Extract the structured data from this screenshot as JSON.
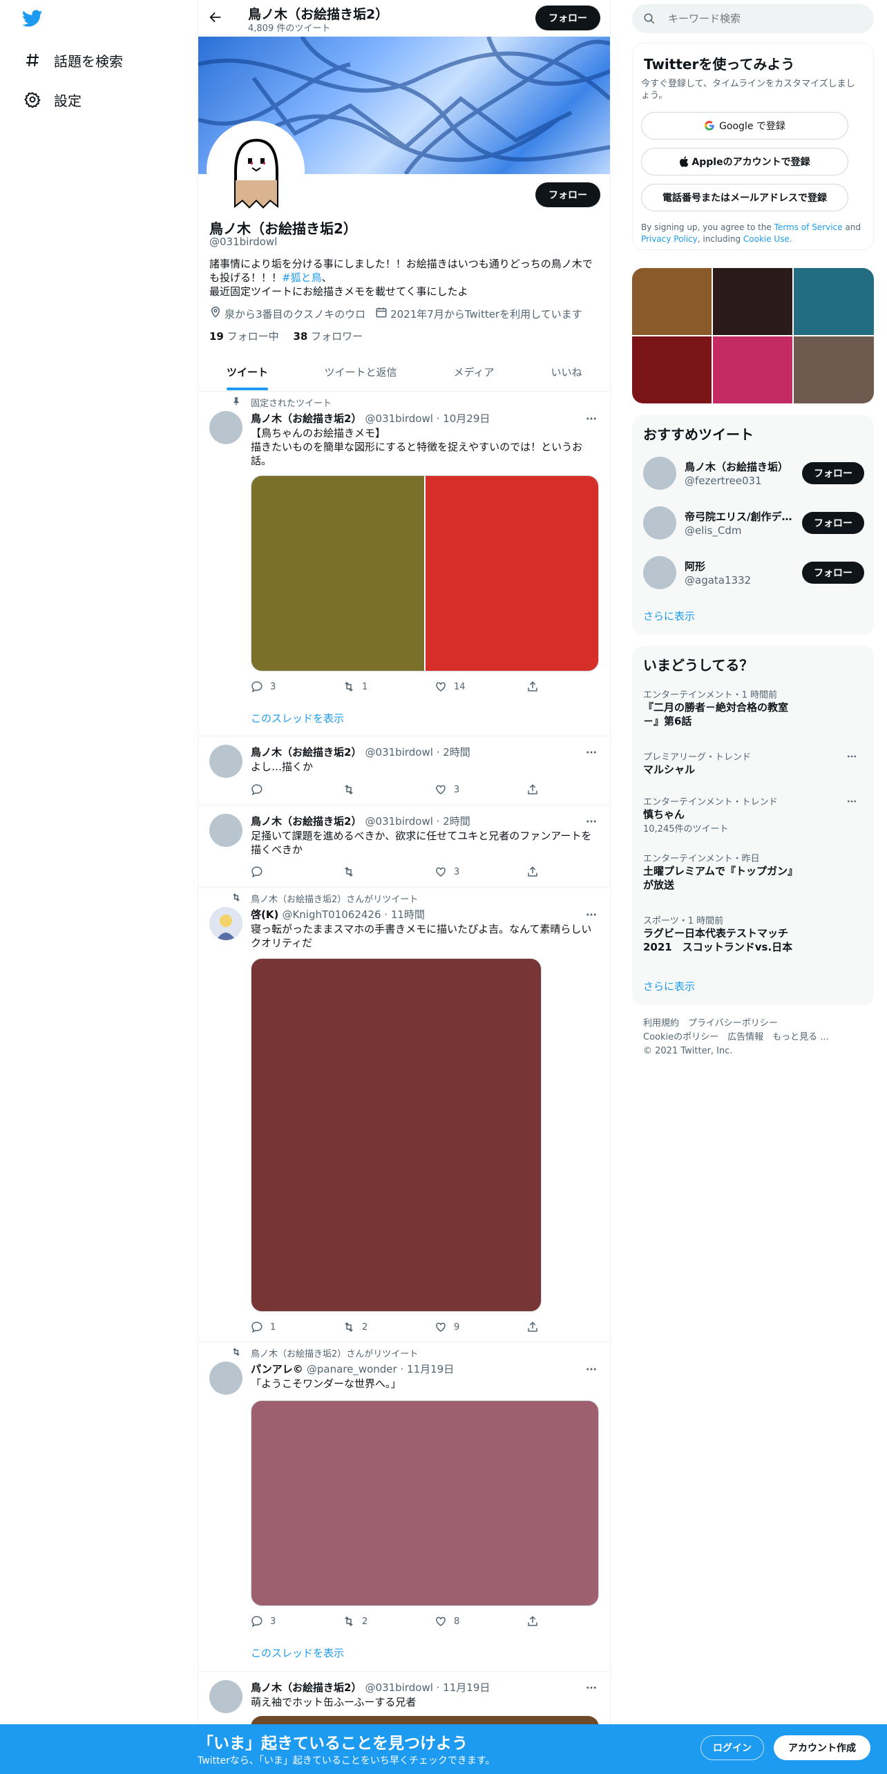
{
  "nav": {
    "explore_label": "話題を検索",
    "settings_label": "設定"
  },
  "header": {
    "title": "鳥ノ木（お絵描き垢2）",
    "tweet_count": "4,809 件のツイート",
    "follow_label": "フォロー"
  },
  "profile": {
    "follow_label": "フォロー",
    "name": "鳥ノ木（お絵描き垢2）",
    "handle": "@031birdowl",
    "bio_line1": "諸事情により垢を分ける事にしました！！お絵描きはいつも通りどっちの鳥ノ木でも投げる！！！",
    "bio_hashtag": "#狐と鳥",
    "bio_comma": "、",
    "bio_line2": "最近固定ツイートにお絵描きメモを載せてく事にしたよ",
    "location": "泉から3番目のクスノキのウロ",
    "joined": "2021年7月からTwitterを利用しています",
    "following_count": "19",
    "following_label": "フォロー中",
    "followers_count": "38",
    "followers_label": "フォロワー"
  },
  "tabs": [
    "ツイート",
    "ツイートと返信",
    "メディア",
    "いいね"
  ],
  "tweets": [
    {
      "context": "固定されたツイート",
      "name": "鳥ノ木（お絵描き垢2）",
      "handle": "@031birdowl",
      "time": "10月29日",
      "text1": "【鳥ちゃんのお絵描きメモ】",
      "text2": "描きたいものを簡単な図形にすると特徴を捉えやすいのでは！というお話。",
      "replies": "3",
      "retweets": "1",
      "likes": "14",
      "thread": "このスレッドを表示",
      "media_colors": [
        "#7a702a",
        "#d62f2a"
      ]
    },
    {
      "name": "鳥ノ木（お絵描き垢2）",
      "handle": "@031birdowl",
      "time": "2時間",
      "text": "よし…描くか",
      "likes": "3"
    },
    {
      "name": "鳥ノ木（お絵描き垢2）",
      "handle": "@031birdowl",
      "time": "2時間",
      "text": "足掻いて課題を進めるべきか、欲求に任せてユキと兄者のファンアートを描くべきか",
      "likes": "3"
    },
    {
      "context": "鳥ノ木（お絵描き垢2）さんがリツイート",
      "name": "啓(K)",
      "handle": "@KnighT01062426",
      "time": "11時間",
      "text": "寝っ転がったままスマホの手書きメモに描いたぴよ吉。なんて素晴らしいクオリティだ",
      "replies": "1",
      "retweets": "2",
      "likes": "9",
      "media_color": "#773536"
    },
    {
      "context": "鳥ノ木（お絵描き垢2）さんがリツイート",
      "name": "パンアレ©",
      "handle": "@panare_wonder",
      "time": "11月19日",
      "text": "「ようこそワンダーな世界へ。」",
      "replies": "3",
      "retweets": "2",
      "likes": "8",
      "thread": "このスレッドを表示",
      "media_color": "#9e606e"
    },
    {
      "name": "鳥ノ木（お絵描き垢2）",
      "handle": "@031birdowl",
      "time": "11月19日",
      "text": "萌え袖でホット缶ふーふーする兄者",
      "media_color": "#6e4a2a"
    }
  ],
  "sidebar": {
    "search_placeholder": "キーワード検索",
    "signup": {
      "title": "Twitterを使ってみよう",
      "subtitle": "今すぐ登録して、タイムラインをカスタマイズしましょう。",
      "google": "Google で登録",
      "apple": "Appleのアカウントで登録",
      "phone": "電話番号またはメールアドレスで登録",
      "legal_a": "By signing up, you agree to the",
      "legal_tos": "Terms of Service",
      "legal_and": "and",
      "legal_privacy": "Privacy Policy",
      "legal_incl": ", including",
      "legal_cookie": "Cookie Use."
    },
    "media_grid_colors": [
      "#8a5a2b",
      "#2a1b1a",
      "#236d82",
      "#7a1417",
      "#c42b63",
      "#6e5a4f"
    ],
    "recommend": {
      "title": "おすすめツイート",
      "users": [
        {
          "name": "鳥ノ木（お絵描き垢）",
          "handle": "@fezertree031",
          "follow": "フォロー"
        },
        {
          "name": "帝弓院エリス/創作デ…",
          "handle": "@elis_Cdm",
          "follow": "フォロー"
        },
        {
          "name": "阿形",
          "handle": "@agata1332",
          "follow": "フォロー"
        }
      ],
      "more": "さらに表示"
    },
    "trends": {
      "title": "いまどうしてる？",
      "items": [
        {
          "cat": "エンターテインメント・1 時間前",
          "title": "『二月の勝者－絶対合格の教室－』第6話"
        },
        {
          "cat": "プレミアリーグ・トレンド",
          "title": "マルシャル"
        },
        {
          "cat": "エンターテインメント・トレンド",
          "title": "慎ちゃん",
          "count": "10,245件のツイート"
        },
        {
          "cat": "エンターテインメント・昨日",
          "title": "土曜プレミアムで『トップガン』が放送"
        },
        {
          "cat": "スポーツ・1 時間前",
          "title": "ラグビー日本代表テストマッチ2021　スコットランドvs.日本"
        }
      ],
      "more": "さらに表示"
    },
    "footer": {
      "line1": "利用規約　プライバシーポリシー",
      "line2": "Cookieのポリシー　広告情報　もっと見る ...",
      "line3": "© 2021 Twitter, Inc."
    }
  },
  "bottom": {
    "title": "「いま」起きていることを見つけよう",
    "subtitle": "Twitterなら、「いま」起きていることをいち早くチェックできます。",
    "login": "ログイン",
    "signup": "アカウント作成"
  }
}
